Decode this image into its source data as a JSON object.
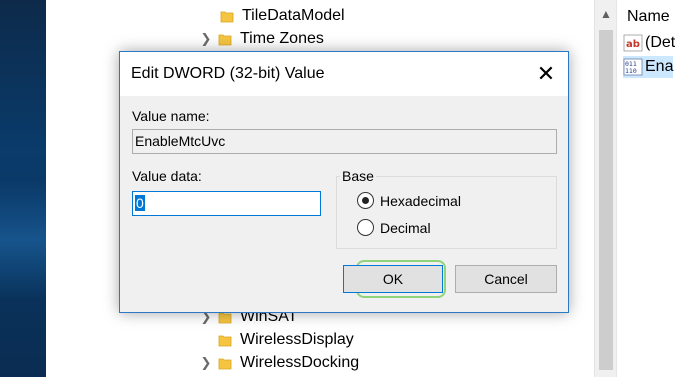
{
  "tree": {
    "items_top": [
      {
        "label": "TileDataModel",
        "has_children": false
      },
      {
        "label": "Time Zones",
        "has_children": true
      }
    ],
    "items_bottom": [
      {
        "label": "WinSAT",
        "has_children": true
      },
      {
        "label": "WirelessDisplay",
        "has_children": false
      },
      {
        "label": "WirelessDocking",
        "has_children": true
      }
    ]
  },
  "values_list": {
    "column_header": "Name",
    "rows": [
      {
        "label": "(Det",
        "icon": "string-value-icon",
        "selected": false
      },
      {
        "label": "Ena",
        "icon": "dword-value-icon",
        "selected": true
      }
    ]
  },
  "dialog": {
    "title": "Edit DWORD (32-bit) Value",
    "value_name_label": "Value name:",
    "value_name": "EnableMtcUvc",
    "value_data_label": "Value data:",
    "value_data": "0",
    "base_label": "Base",
    "radios": [
      {
        "label": "Hexadecimal",
        "checked": true
      },
      {
        "label": "Decimal",
        "checked": false
      }
    ],
    "ok_label": "OK",
    "cancel_label": "Cancel"
  },
  "colors": {
    "accent": "#0078d7",
    "highlight_ring": "#8fd37a",
    "selection": "#cce8ff",
    "folder": "#f5c542"
  }
}
